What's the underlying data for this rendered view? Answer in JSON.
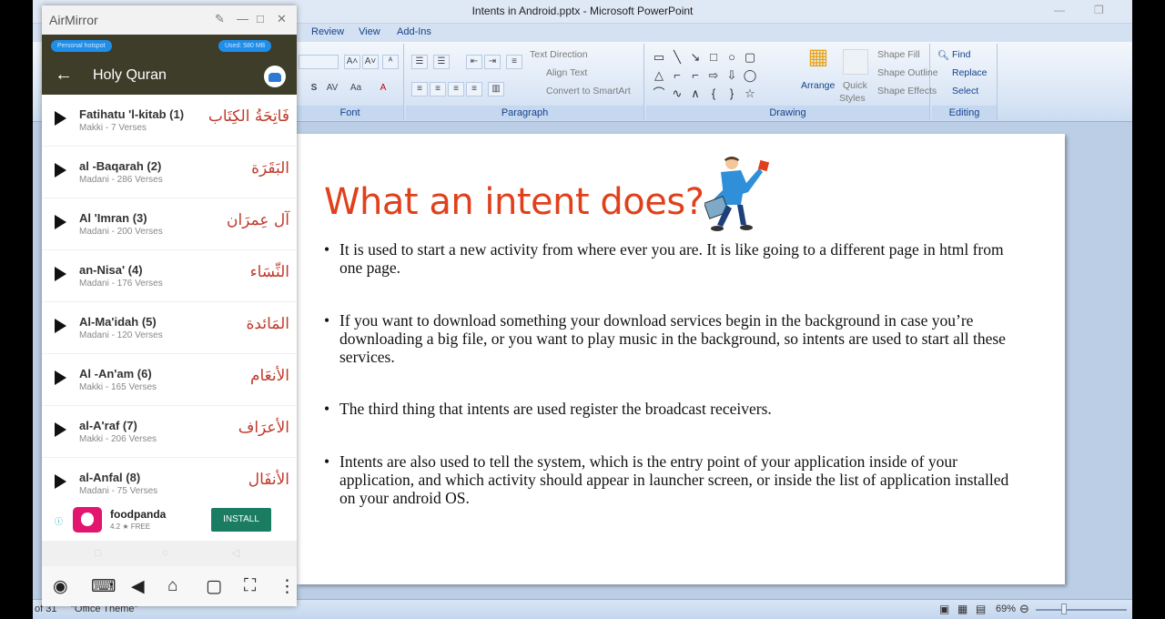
{
  "ppt": {
    "title": "Intents in Android.pptx - Microsoft PowerPoint",
    "tabs": [
      "Review",
      "View",
      "Add-Ins"
    ],
    "ribbon": {
      "font_group": "Font",
      "paragraph_group": "Paragraph",
      "drawing_group": "Drawing",
      "editing_group": "Editing",
      "text_direction": "Text Direction",
      "align_text": "Align Text",
      "convert_smartart": "Convert to SmartArt",
      "arrange": "Arrange",
      "quick_styles_1": "Quick",
      "quick_styles_2": "Styles",
      "shape_fill": "Shape Fill",
      "shape_outline": "Shape Outline",
      "shape_effects": "Shape Effects",
      "find": "Find",
      "replace": "Replace",
      "select": "Select"
    },
    "slide": {
      "title": "What an intent does?",
      "bullets": [
        "It is used to start a new activity from where ever you are. It is like going to a different page in html from one page.",
        "If you want to download something your download services begin in the background in case you’re downloading a big file, or you want to play music in the background, so intents are used to start all these services.",
        "The third thing that intents are used register the broadcast receivers.",
        "Intents are also used to tell the system, which is the entry point of your application inside of your application, and which activity should appear in launcher screen, or inside the list of application installed on your android OS."
      ]
    },
    "status": {
      "slide_of": "of 31",
      "theme": "\"Office Theme\"",
      "zoom": "69%"
    }
  },
  "airmirror": {
    "title": "AirMirror",
    "pill_left": "Personal hotspot",
    "pill_right": "Used: 580 MB",
    "app_title": "Holy Quran",
    "surahs": [
      {
        "name": "Fatihatu 'l-kitab (1)",
        "sub": "Makki - 7 Verses",
        "arabic": "فَاتِحَةُ الكِتَاب"
      },
      {
        "name": "al -Baqarah (2)",
        "sub": "Madani - 286 Verses",
        "arabic": "البَقَرَة"
      },
      {
        "name": "Al 'Imran (3)",
        "sub": "Madani - 200 Verses",
        "arabic": "آل عِمرَان"
      },
      {
        "name": "an-Nisa' (4)",
        "sub": "Madani - 176 Verses",
        "arabic": "النِّسَاء"
      },
      {
        "name": "Al-Ma'idah (5)",
        "sub": "Madani - 120 Verses",
        "arabic": "المَائدة"
      },
      {
        "name": "Al -An'am (6)",
        "sub": "Makki - 165 Verses",
        "arabic": "الأنعَام"
      },
      {
        "name": "al-A'raf (7)",
        "sub": "Makki - 206 Verses",
        "arabic": "الأعرَاف"
      },
      {
        "name": "al-Anfal (8)",
        "sub": "Madani - 75 Verses",
        "arabic": "الأنفَال"
      }
    ],
    "ad": {
      "name": "foodpanda",
      "rating": "4.2 ★ FREE",
      "install": "INSTALL"
    }
  }
}
